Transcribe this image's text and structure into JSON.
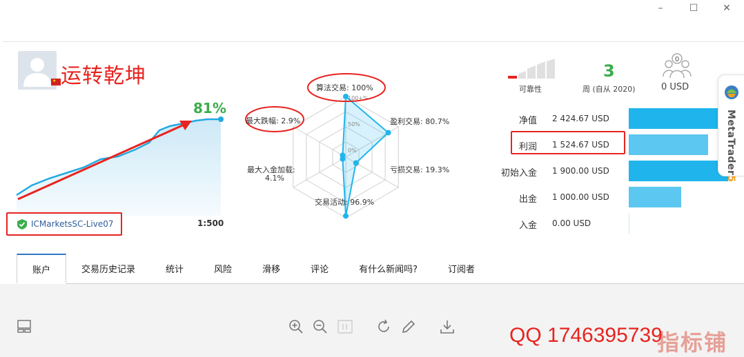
{
  "window": {
    "minimize": "–",
    "maximize": "☐",
    "close": "✕"
  },
  "account": {
    "name": "运转乾坤",
    "flag_country": "china",
    "server": "ICMarketsSC-Live07",
    "leverage": "1:500",
    "growth": "81%"
  },
  "radar": {
    "labels": {
      "algo": "算法交易: 100%",
      "profit_trades": "盈利交易: 80.7%",
      "loss_trades": "亏损交易: 19.3%",
      "activity": "交易活动: 96.9%",
      "max_deposit_load_title": "最大入金加载:",
      "max_deposit_load_value": "4.1%",
      "max_drawdown": "最大跌幅: 2.9%"
    },
    "ring_labels": {
      "r100": "100+%",
      "r50": "50%",
      "r0": "0%"
    },
    "values": {
      "algo": 100,
      "profit_trades": 80.7,
      "loss_trades": 19.3,
      "activity": 96.9,
      "max_deposit_load": 4.1,
      "max_drawdown": 2.9
    }
  },
  "stats": {
    "reliability_label": "可靠性",
    "reliability_level": 0.2,
    "weeks_value": "3",
    "weeks_label": "周 (自从 2020)",
    "subscribers_count": "0",
    "subscribers_value": "0 USD"
  },
  "financials": [
    {
      "label": "净值",
      "value": "2 424.67 USD",
      "fraction": 1.0,
      "color": "#1fb5ec"
    },
    {
      "label": "利润",
      "value": "1 524.67 USD",
      "fraction": 0.7,
      "color": "#5cc7f0"
    },
    {
      "label": "初始入金",
      "value": "1 900.00 USD",
      "fraction": 0.87,
      "color": "#1fb5ec"
    },
    {
      "label": "出金",
      "value": "1 000.00 USD",
      "fraction": 0.46,
      "color": "#5cc7f0"
    },
    {
      "label": "入金",
      "value": "0.00 USD",
      "fraction": 0.0,
      "color": "#5cc7f0"
    }
  ],
  "metatrader": {
    "brand": "MetaTrader",
    "version": "5"
  },
  "tabs": [
    "账户",
    "交易历史记录",
    "统计",
    "风险",
    "滑移",
    "评论",
    "有什么新闻吗?",
    "订阅者"
  ],
  "toolbar": [
    "layout-icon",
    "zoom-in-icon",
    "zoom-out-icon",
    "fit-icon",
    "refresh-icon",
    "edit-icon",
    "download-icon"
  ],
  "overlay": {
    "qq": "QQ 1746395739",
    "watermark": "指标铺"
  },
  "colors": {
    "accent_red": "#e8231f",
    "green": "#3aad4c",
    "blue": "#1fb5ec"
  }
}
